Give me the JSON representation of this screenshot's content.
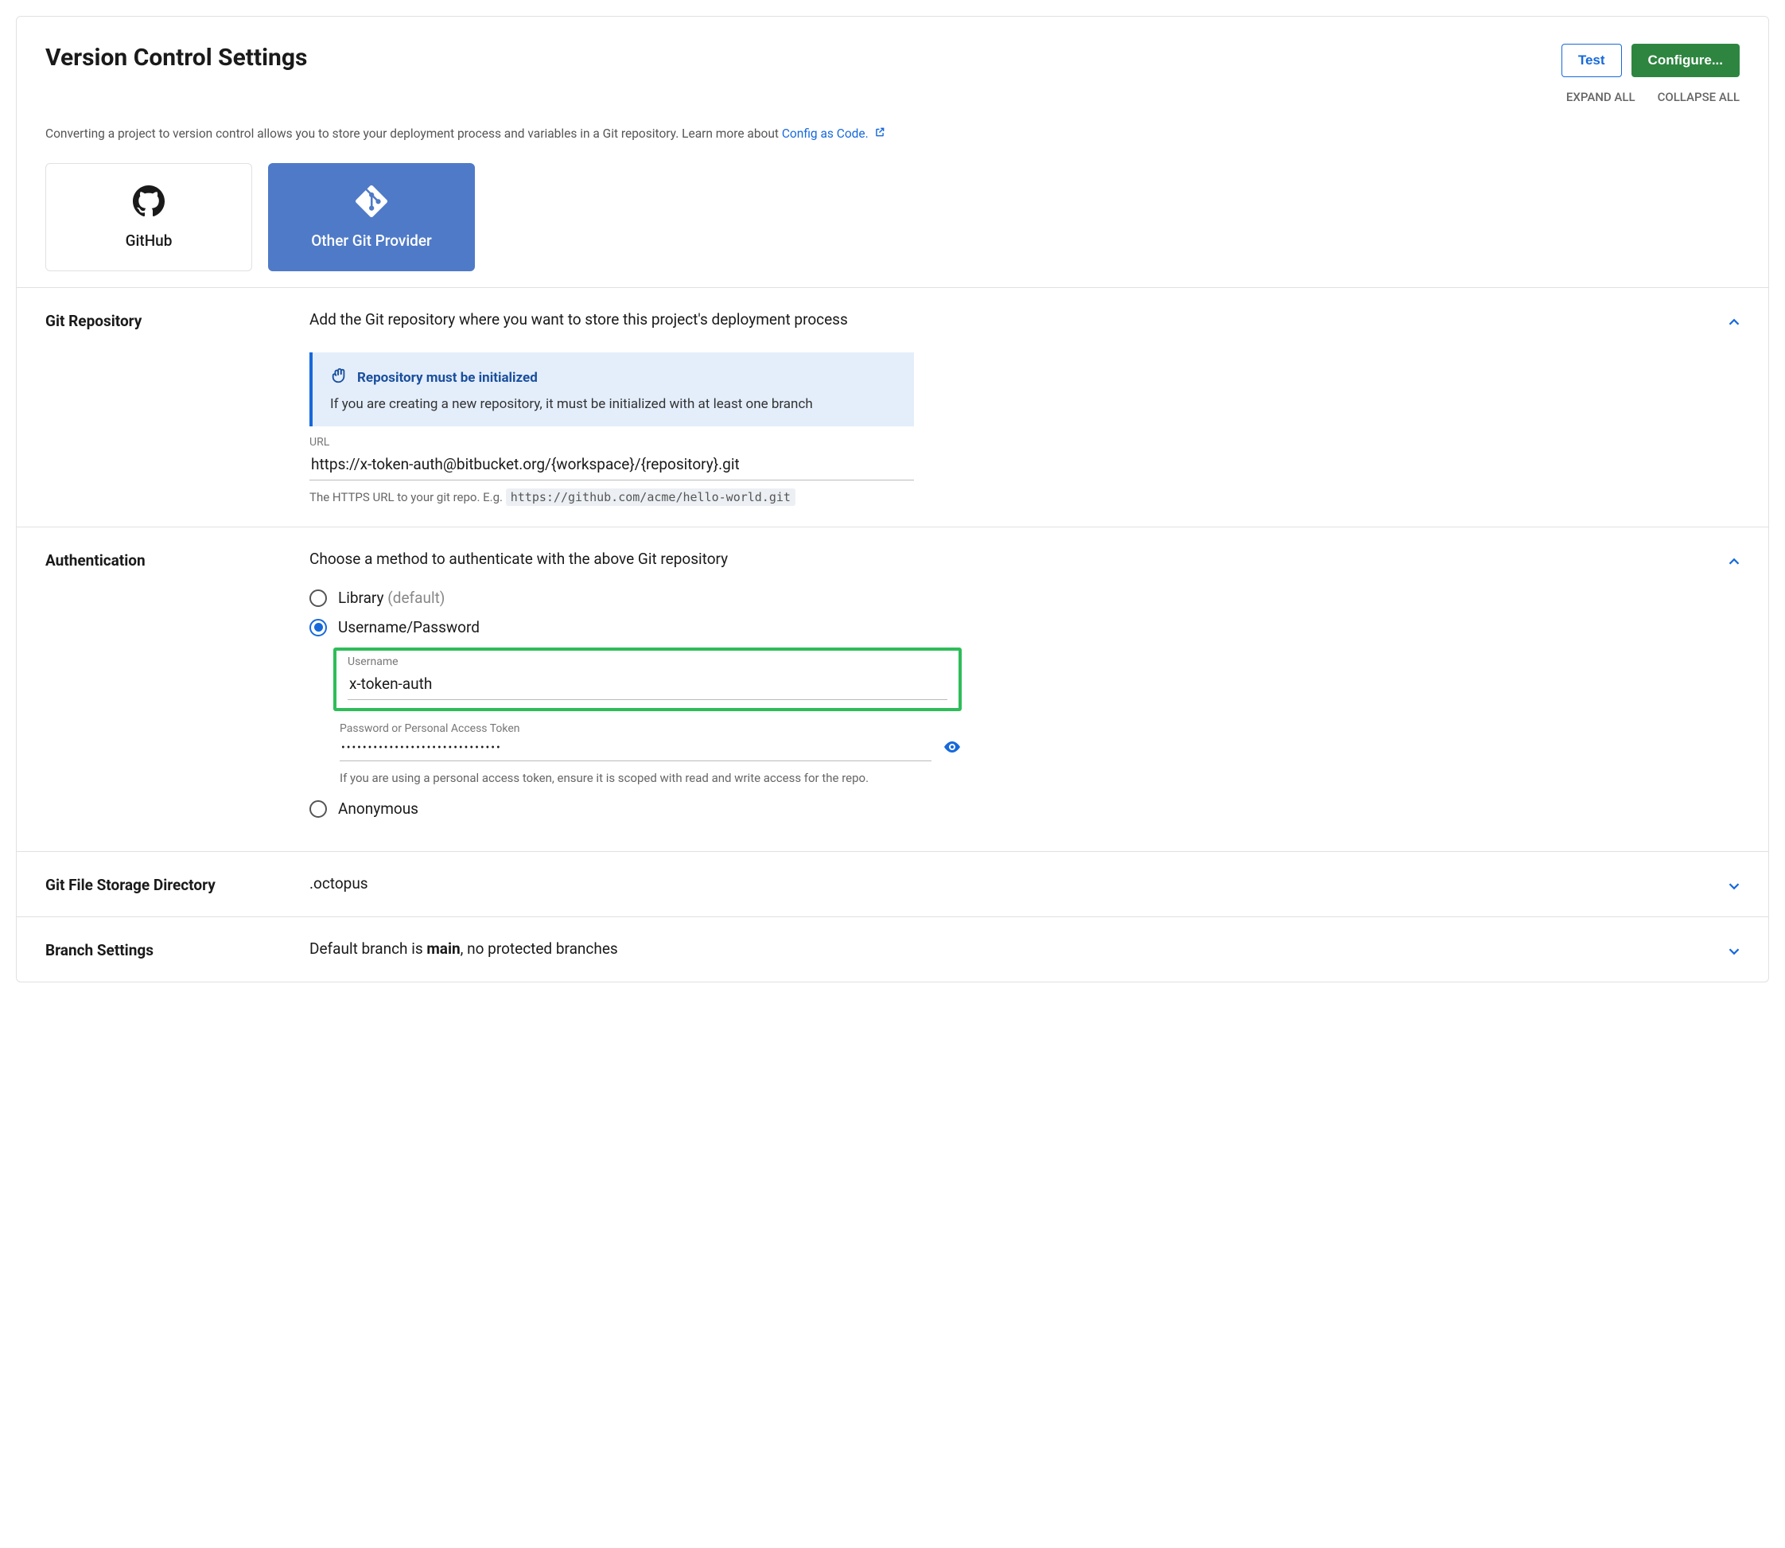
{
  "header": {
    "title": "Version Control Settings",
    "test_label": "Test",
    "configure_label": "Configure...",
    "expand_all": "EXPAND ALL",
    "collapse_all": "COLLAPSE ALL",
    "intro_text": "Converting a project to version control allows you to store your deployment process and variables in a Git repository. Learn more about ",
    "intro_link": "Config as Code."
  },
  "providers": {
    "github": "GitHub",
    "other": "Other Git Provider"
  },
  "repo": {
    "label": "Git Repository",
    "summary": "Add the Git repository where you want to store this project's deployment process",
    "callout_title": "Repository must be initialized",
    "callout_body": "If you are creating a new repository, it must be initialized with at least one branch",
    "url_label": "URL",
    "url_value": "https://x-token-auth@bitbucket.org/{workspace}/{repository}.git",
    "url_help": "The HTTPS URL to your git repo. E.g. ",
    "url_example": "https://github.com/acme/hello-world.git"
  },
  "auth": {
    "label": "Authentication",
    "summary": "Choose a method to authenticate with the above Git repository",
    "opt_library": "Library",
    "opt_library_suffix": " (default)",
    "opt_userpass": "Username/Password",
    "opt_anon": "Anonymous",
    "username_label": "Username",
    "username_value": "x-token-auth",
    "password_label": "Password or Personal Access Token",
    "password_value": "••••••••••••••••••••••••••••••",
    "pat_help": "If you are using a personal access token, ensure it is scoped with read and write access for the repo."
  },
  "storage": {
    "label": "Git File Storage Directory",
    "value": ".octopus"
  },
  "branch": {
    "label": "Branch Settings",
    "prefix": "Default branch is ",
    "main": "main",
    "suffix": ", no protected branches"
  }
}
